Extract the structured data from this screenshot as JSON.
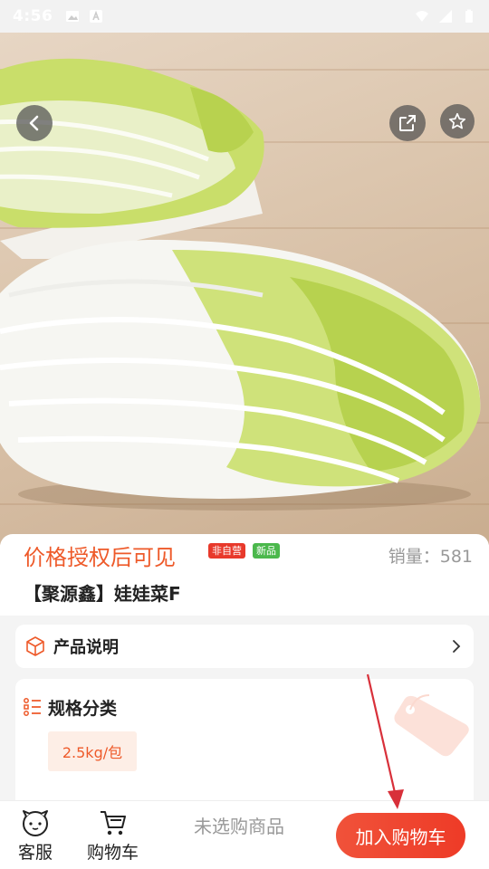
{
  "status_bar": {
    "time": "4:56",
    "left_icons": [
      "image-icon",
      "a-badge-icon"
    ],
    "right_icons": [
      "wifi-icon",
      "signal-icon",
      "battery-icon"
    ]
  },
  "header": {
    "back_icon": "chevron-left-icon",
    "share_icon": "share-icon",
    "favorite_icon": "star-icon"
  },
  "product": {
    "price_text": "价格授权后可见",
    "badges": [
      "非自营",
      "新品"
    ],
    "sales_label": "销量：581",
    "name": "【聚源鑫】娃娃菜F"
  },
  "description_row": {
    "label": "产品说明",
    "icon": "box-icon"
  },
  "spec": {
    "title": "规格分类",
    "icon": "list-icon",
    "options": [
      "2.5kg/包"
    ]
  },
  "bottom_bar": {
    "service_label": "客服",
    "cart_label": "购物车",
    "hint": "未选购商品",
    "add_to_cart": "加入购物车"
  },
  "colors": {
    "accent": "#ee5a2a",
    "button": "#ee3b27",
    "badge_red": "#e8392b",
    "badge_green": "#4bb84c"
  }
}
